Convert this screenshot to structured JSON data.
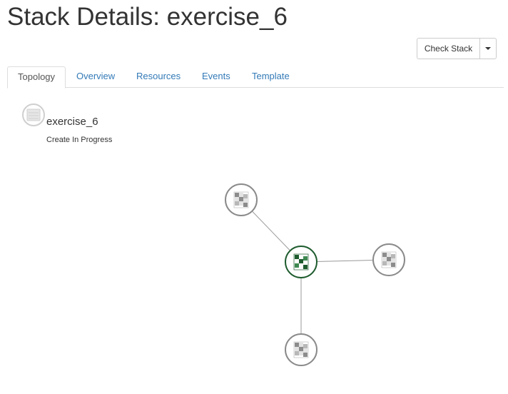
{
  "page": {
    "title": "Stack Details: exercise_6"
  },
  "actions": {
    "check_stack_label": "Check Stack"
  },
  "tabs": [
    {
      "label": "Topology",
      "active": true
    },
    {
      "label": "Overview",
      "active": false
    },
    {
      "label": "Resources",
      "active": false
    },
    {
      "label": "Events",
      "active": false
    },
    {
      "label": "Template",
      "active": false
    }
  ],
  "stack": {
    "name": "exercise_6",
    "status": "Create In Progress",
    "icon": "stack-icon"
  },
  "topology": {
    "nodes": [
      {
        "id": "top",
        "status": "init",
        "icon": "resource-icon"
      },
      {
        "id": "center",
        "status": "in-progress",
        "icon": "resource-icon"
      },
      {
        "id": "right",
        "status": "init",
        "icon": "resource-icon"
      },
      {
        "id": "bottom",
        "status": "init",
        "icon": "resource-icon"
      }
    ],
    "links": [
      {
        "from": "center",
        "to": "top"
      },
      {
        "from": "center",
        "to": "right"
      },
      {
        "from": "center",
        "to": "bottom"
      }
    ],
    "colors": {
      "init": "#8a8a8a",
      "in_progress": "#1e5c2e",
      "link": "#999999"
    }
  },
  "colors": {
    "link_text": "#337ab7",
    "border": "#dddddd"
  }
}
